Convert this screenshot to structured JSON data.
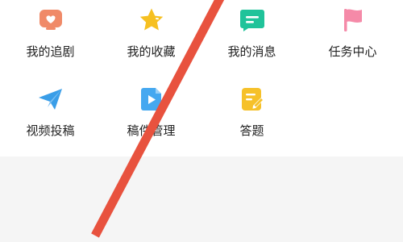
{
  "menu": {
    "items": [
      {
        "label": "我的追剧",
        "icon": "heart-tv-icon",
        "color": "#f08a68"
      },
      {
        "label": "我的收藏",
        "icon": "star-icon",
        "color": "#f6c021"
      },
      {
        "label": "我的消息",
        "icon": "message-icon",
        "color": "#20c39a"
      },
      {
        "label": "任务中心",
        "icon": "flag-icon",
        "color": "#f58aa8"
      },
      {
        "label": "视频投稿",
        "icon": "paper-plane-icon",
        "color": "#3a9ee8"
      },
      {
        "label": "稿件管理",
        "icon": "video-file-icon",
        "color": "#45a8f0"
      },
      {
        "label": "答题",
        "icon": "edit-note-icon",
        "color": "#f6c12a"
      }
    ]
  },
  "overlay": {
    "icon": "diagonal-strike-line",
    "color": "#e8523e"
  }
}
